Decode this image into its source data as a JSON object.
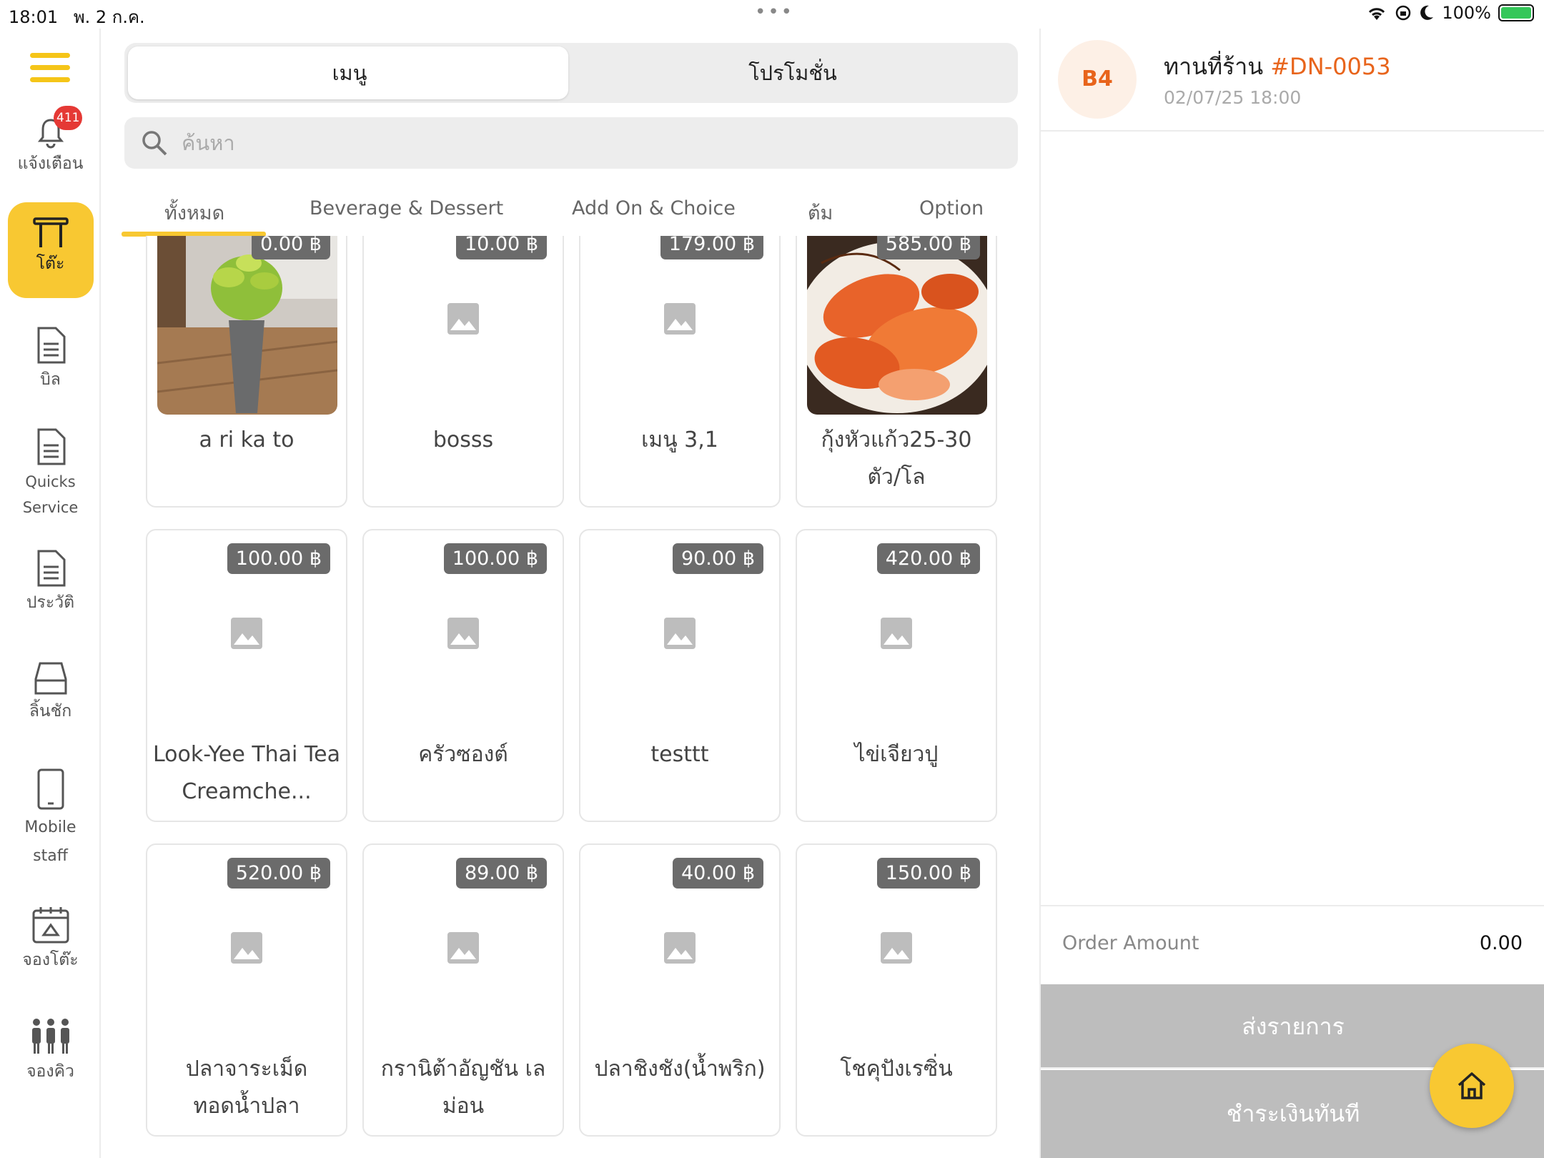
{
  "status_bar": {
    "time": "18:01",
    "date": "พ. 2 ก.ค.",
    "battery": "100%"
  },
  "sidebar": {
    "notification_badge": "411",
    "items": [
      {
        "label": "แจ้งเตือน"
      },
      {
        "label": "โต๊ะ"
      },
      {
        "label": "บิล"
      },
      {
        "label": "Quicks Service"
      },
      {
        "label": "ประวัติ"
      },
      {
        "label": "ลิ้นชัก"
      },
      {
        "label": "Mobile staff"
      },
      {
        "label": "จองโต๊ะ"
      },
      {
        "label": "จองคิว"
      }
    ]
  },
  "segments": {
    "menu": "เมนู",
    "promotion": "โปรโมชั่น"
  },
  "search": {
    "placeholder": "ค้นหา"
  },
  "categories": [
    "ทั้งหมด",
    "Beverage & Dessert",
    "Add On & Choice",
    "ต้ม",
    "Option"
  ],
  "products": [
    {
      "name": "a ri ka to",
      "price": "0.00 ฿"
    },
    {
      "name": "bosss",
      "price": "10.00 ฿"
    },
    {
      "name": "เมนู 3,1",
      "price": "179.00 ฿"
    },
    {
      "name": "กุ้งหัวแก้ว25-30 ตัว/โล",
      "price": "585.00 ฿"
    },
    {
      "name": "Look-Yee Thai Tea Creamche...",
      "price": "100.00 ฿"
    },
    {
      "name": "ครัวซองต์",
      "price": "100.00 ฿"
    },
    {
      "name": "testtt",
      "price": "90.00 ฿"
    },
    {
      "name": "ไข่เจียวปู",
      "price": "420.00 ฿"
    },
    {
      "name": "ปลาจาระเม็ดทอดน้ำปลา",
      "price": "520.00 ฿"
    },
    {
      "name": "กรานิต้าอัญชัน เลม่อน",
      "price": "89.00 ฿"
    },
    {
      "name": "ปลาชิงชัง(น้ำพริก)",
      "price": "40.00 ฿"
    },
    {
      "name": "โชคุปังเรซิ่น",
      "price": "150.00 ฿"
    }
  ],
  "order": {
    "table": "B4",
    "type": "ทานที่ร้าน",
    "code": "#DN-0053",
    "datetime": "02/07/25 18:00",
    "amount_label": "Order Amount",
    "amount_value": "0.00",
    "send_label": "ส่งรายการ",
    "pay_label": "ชำระเงินทันที"
  },
  "colors": {
    "accent": "#f8c832",
    "order_code": "#e8641b",
    "price_tag": "#6b6b6b"
  }
}
